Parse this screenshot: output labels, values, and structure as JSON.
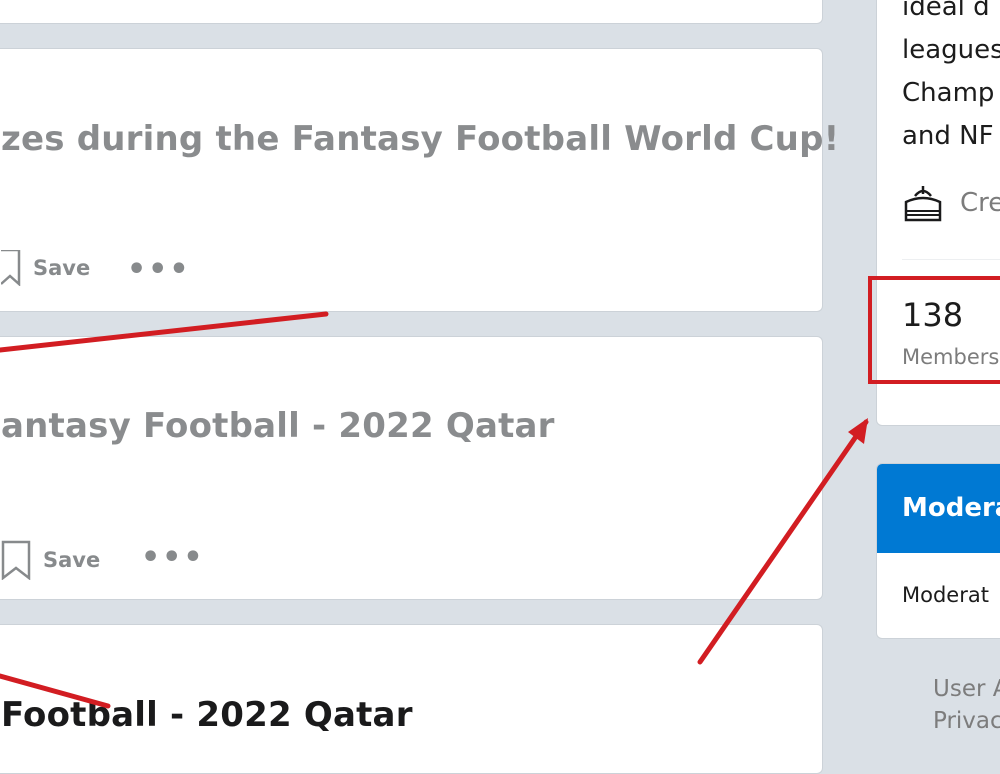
{
  "posts": [
    {
      "title": "zes during the Fantasy Football World Cup!",
      "save_label": "Save",
      "more_label": "•••"
    },
    {
      "title": "antasy Football - 2022 Qatar",
      "save_label": "Save",
      "more_label": "•••"
    },
    {
      "title": "Football - 2022 Qatar"
    }
  ],
  "sidebar": {
    "about_lines": [
      "ideal d",
      "leagues",
      "Champ",
      "and NF"
    ],
    "created_label": "Cre",
    "members_count": "138",
    "members_label": "Members",
    "moderators_header": "Modera",
    "moderators_label": "Moderat",
    "footer_links": [
      "User A",
      "Privac"
    ]
  },
  "colors": {
    "page_bg": "#dae0e6",
    "card_bg": "#ffffff",
    "accent_blue": "#0079d3",
    "annotation_red": "#d21d22"
  }
}
